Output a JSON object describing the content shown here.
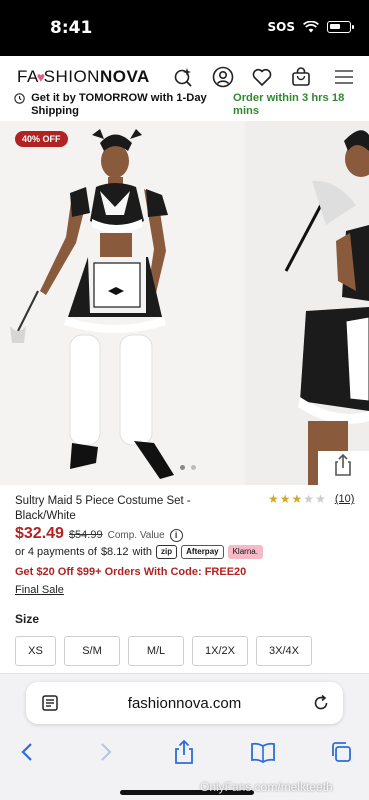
{
  "status_bar": {
    "time": "8:41",
    "sos": "SOS",
    "battery_level": 0.6
  },
  "header": {
    "logo_part1": "FA",
    "logo_part2": "SHION",
    "logo_part3": "NOVA",
    "icons": [
      "sparkle-search-icon",
      "account-icon",
      "heart-icon",
      "bag-icon",
      "menu-icon"
    ]
  },
  "shipping": {
    "left_text": "Get it by TOMORROW with 1-Day Shipping",
    "right_text": "Order within 3 hrs 18 mins"
  },
  "gallery": {
    "badge": "40% OFF",
    "dots_count": 2,
    "active_dot": 0
  },
  "product": {
    "title": "Sultry Maid 5 Piece Costume Set - Black/White",
    "rating": 3,
    "rating_max": 5,
    "rating_count": "(10)",
    "price": "$32.49",
    "old_price": "$54.99",
    "comp_value": "Comp. Value",
    "installments_prefix": "or 4 payments of",
    "installment_amount": "$8.12",
    "installments_with": "with",
    "pay_zip": "zip",
    "pay_afterpay": "Afterpay",
    "pay_klarna": "Klarna.",
    "promo": "Get $20 Off $99+ Orders With Code: FREE20",
    "final_sale": "Final Sale",
    "size_label": "Size",
    "sizes": [
      "XS",
      "S/M",
      "M/L",
      "1X/2X",
      "3X/4X"
    ]
  },
  "safari": {
    "url": "fashionnova.com",
    "icons": [
      "back-icon",
      "forward-icon",
      "share-icon",
      "bookmarks-icon",
      "tabs-icon"
    ]
  },
  "watermark": "OnlyFans.com/melkteeth",
  "colors": {
    "accent_red": "#b12323",
    "green": "#2f8a2f",
    "star": "#d6a62b"
  }
}
